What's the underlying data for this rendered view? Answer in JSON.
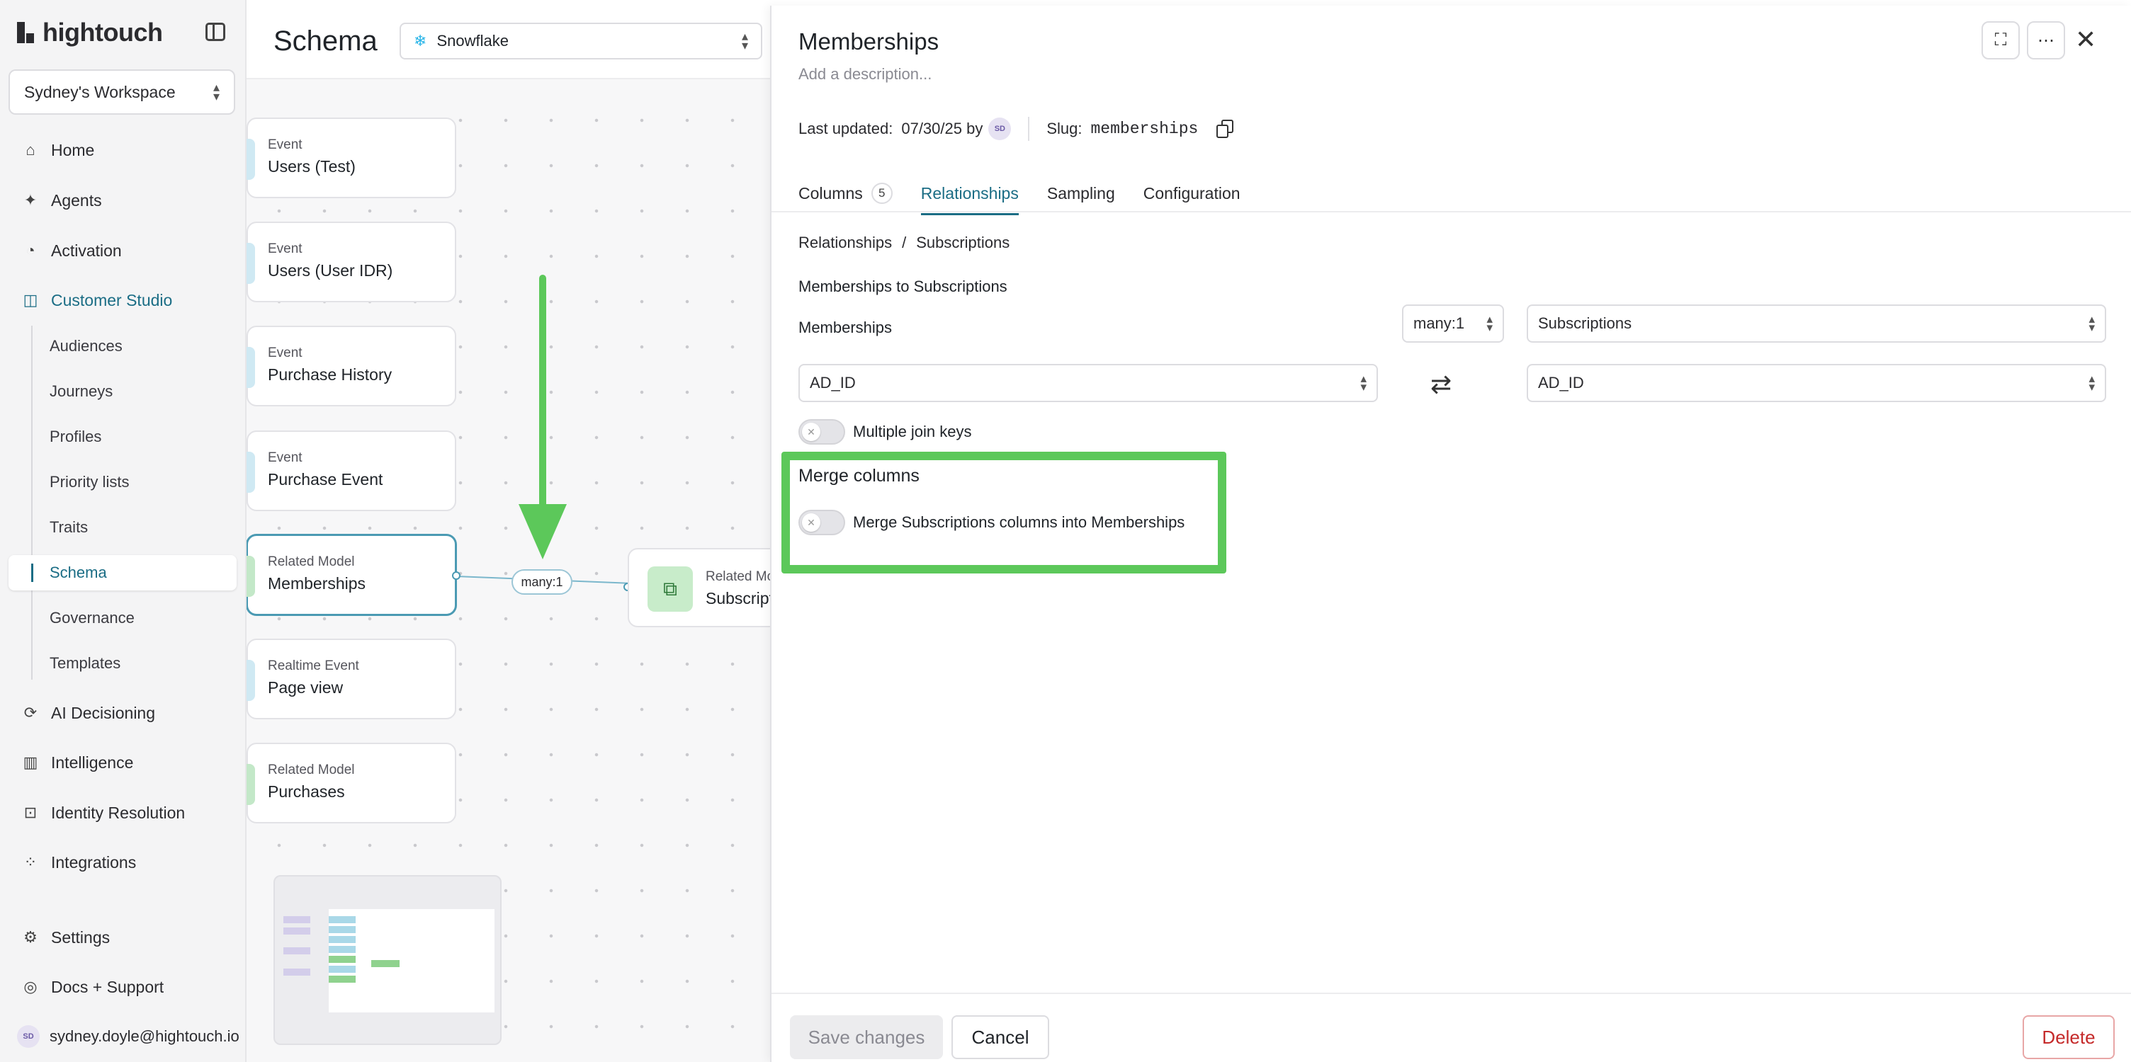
{
  "app": {
    "logo_text": "hightouch"
  },
  "workspace": {
    "name": "Sydney's Workspace"
  },
  "nav": {
    "home": "Home",
    "agents": "Agents",
    "activation": "Activation",
    "customer_studio": "Customer Studio",
    "sub": [
      "Audiences",
      "Journeys",
      "Profiles",
      "Priority lists",
      "Traits",
      "Schema",
      "Governance",
      "Templates"
    ],
    "ai_decisioning": "AI Decisioning",
    "intelligence": "Intelligence",
    "identity_resolution": "Identity Resolution",
    "integrations": "Integrations",
    "settings": "Settings",
    "docs_support": "Docs + Support"
  },
  "user": {
    "initials": "SD",
    "email": "sydney.doyle@hightouch.io"
  },
  "schema": {
    "title": "Schema",
    "source": "Snowflake",
    "nodes": [
      {
        "type": "Event",
        "name": "Users (Test)"
      },
      {
        "type": "Event",
        "name": "Users (User IDR)"
      },
      {
        "type": "Event",
        "name": "Purchase History"
      },
      {
        "type": "Event",
        "name": "Purchase Event"
      },
      {
        "type": "Related Model",
        "name": "Memberships"
      },
      {
        "type": "Realtime Event",
        "name": "Page view"
      },
      {
        "type": "Related Model",
        "name": "Purchases"
      }
    ],
    "right_node": {
      "type": "Related Model",
      "name": "Subscriptions"
    },
    "relationship_badge": "many:1"
  },
  "panel": {
    "title": "Memberships",
    "description_placeholder": "Add a description...",
    "last_updated_label": "Last updated:",
    "last_updated_value": "07/30/25 by",
    "updated_by_initials": "SD",
    "slug_label": "Slug:",
    "slug_value": "memberships",
    "tabs": {
      "columns": "Columns",
      "columns_count": "5",
      "relationships": "Relationships",
      "sampling": "Sampling",
      "configuration": "Configuration"
    },
    "breadcrumb": {
      "root": "Relationships",
      "sep": "/",
      "current": "Subscriptions"
    },
    "relationship_title": "Memberships to Subscriptions",
    "from_model": "Memberships",
    "cardinality": "many:1",
    "to_model": "Subscriptions",
    "from_key": "AD_ID",
    "to_key": "AD_ID",
    "multiple_join_keys_label": "Multiple join keys",
    "multiple_join_keys_enabled": false,
    "merge_columns_title": "Merge columns",
    "merge_columns_label": "Merge Subscriptions columns into Memberships",
    "merge_columns_enabled": false,
    "buttons": {
      "save": "Save changes",
      "cancel": "Cancel",
      "delete": "Delete"
    }
  },
  "colors": {
    "accent": "#1b6d85",
    "highlight": "#5cc85a",
    "danger": "#c52a2a"
  }
}
